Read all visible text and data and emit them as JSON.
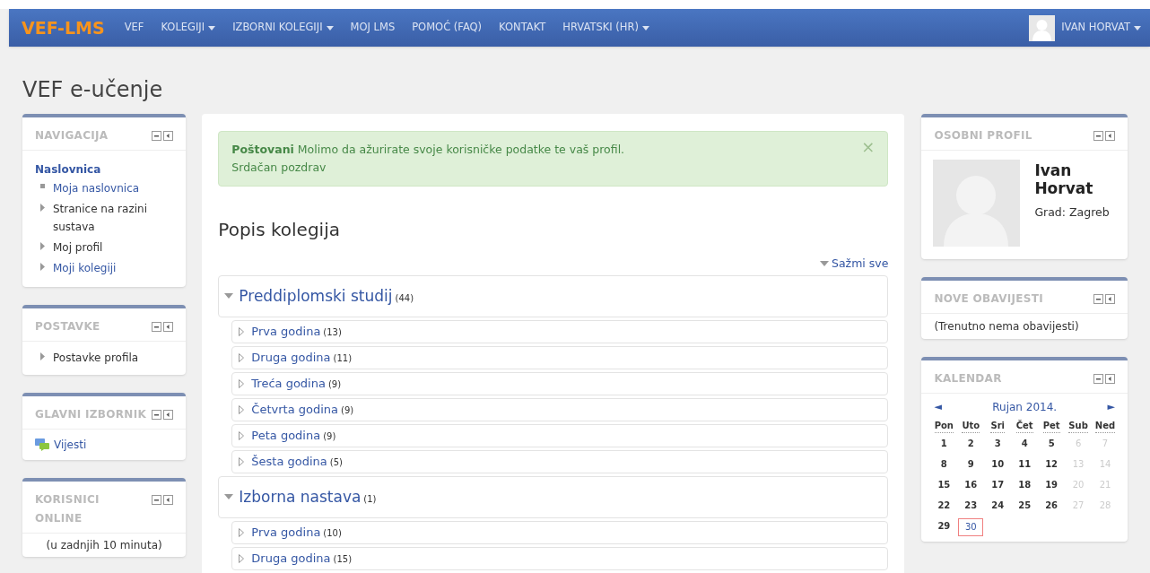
{
  "navbar": {
    "brand": "VEF-LMS",
    "items": [
      {
        "label": "VEF",
        "dropdown": false
      },
      {
        "label": "KOLEGIJI",
        "dropdown": true
      },
      {
        "label": "IZBORNI KOLEGIJI",
        "dropdown": true
      },
      {
        "label": "MOJ LMS",
        "dropdown": false
      },
      {
        "label": "POMOĆ (FAQ)",
        "dropdown": false
      },
      {
        "label": "KONTAKT",
        "dropdown": false
      },
      {
        "label": "HRVATSKI (HR)",
        "dropdown": true
      }
    ],
    "user": "IVAN HORVAT"
  },
  "page_title": "VEF e-učenje",
  "left_blocks": [
    {
      "kind": "tree",
      "title": "NAVIGACIJA",
      "root": "Naslovnica",
      "items": [
        {
          "label": "Moja naslovnica",
          "kind": "leaf",
          "link": true
        },
        {
          "label": "Stranice na razini sustava",
          "kind": "branch",
          "link": false
        },
        {
          "label": "Moj profil",
          "kind": "branch",
          "link": false
        },
        {
          "label": "Moji kolegiji",
          "kind": "branch",
          "link": true
        }
      ]
    },
    {
      "kind": "list",
      "title": "POSTAVKE",
      "items": [
        {
          "label": "Postavke profila",
          "kind": "branch",
          "link": false
        }
      ]
    },
    {
      "kind": "menu",
      "title": "GLAVNI IZBORNIK",
      "items": [
        {
          "label": "Vijesti"
        }
      ]
    },
    {
      "kind": "text",
      "title": "KORISNICI ONLINE",
      "text": "(u zadnjih 10 minuta)"
    }
  ],
  "alert": {
    "bold": "Poštovani",
    "message": "Molimo da ažurirate svoje korisničke podatke te vaš profil.",
    "line2": "Srdačan pozdrav",
    "close": "×"
  },
  "course_list": {
    "title": "Popis kolegija",
    "collapse_all": "Sažmi sve",
    "categories": [
      {
        "name": "Preddiplomski studij",
        "count": "(44)",
        "expanded": true,
        "children": [
          {
            "name": "Prva godina",
            "count": "(13)",
            "expanded": false
          },
          {
            "name": "Druga godina",
            "count": "(11)",
            "expanded": false
          },
          {
            "name": "Treća godina",
            "count": "(9)",
            "expanded": false
          },
          {
            "name": "Četvrta godina",
            "count": "(9)",
            "expanded": false
          },
          {
            "name": "Peta godina",
            "count": "(9)",
            "expanded": false
          },
          {
            "name": "Šesta godina",
            "count": "(5)",
            "expanded": false
          }
        ]
      },
      {
        "name": "Izborna nastava",
        "count": "(1)",
        "expanded": true,
        "children": [
          {
            "name": "Prva godina",
            "count": "(10)",
            "expanded": false
          },
          {
            "name": "Druga godina",
            "count": "(15)",
            "expanded": false
          }
        ]
      }
    ]
  },
  "right_blocks": [
    {
      "kind": "profile",
      "title": "OSOBNI PROFIL",
      "first_name": "Ivan",
      "last_name": "Horvat",
      "city": "Grad: Zagreb"
    },
    {
      "kind": "text",
      "title": "NOVE OBAVIJESTI",
      "text": "(Trenutno nema obavijesti)"
    },
    {
      "kind": "calendar",
      "title": "KALENDAR",
      "month": "Rujan 2014.",
      "prev": "◄",
      "next": "►",
      "weekdays": [
        "Pon",
        "Uto",
        "Sri",
        "Čet",
        "Pet",
        "Sub",
        "Ned"
      ],
      "weeks": [
        [
          {
            "day": "1",
            "weekend": false,
            "today": false
          },
          {
            "day": "2",
            "weekend": false,
            "today": false
          },
          {
            "day": "3",
            "weekend": false,
            "today": false
          },
          {
            "day": "4",
            "weekend": false,
            "today": false
          },
          {
            "day": "5",
            "weekend": false,
            "today": false
          },
          {
            "day": "6",
            "weekend": true,
            "today": false
          },
          {
            "day": "7",
            "weekend": true,
            "today": false
          }
        ],
        [
          {
            "day": "8",
            "weekend": false,
            "today": false
          },
          {
            "day": "9",
            "weekend": false,
            "today": false
          },
          {
            "day": "10",
            "weekend": false,
            "today": false
          },
          {
            "day": "11",
            "weekend": false,
            "today": false
          },
          {
            "day": "12",
            "weekend": false,
            "today": false
          },
          {
            "day": "13",
            "weekend": true,
            "today": false
          },
          {
            "day": "14",
            "weekend": true,
            "today": false
          }
        ],
        [
          {
            "day": "15",
            "weekend": false,
            "today": false
          },
          {
            "day": "16",
            "weekend": false,
            "today": false
          },
          {
            "day": "17",
            "weekend": false,
            "today": false
          },
          {
            "day": "18",
            "weekend": false,
            "today": false
          },
          {
            "day": "19",
            "weekend": false,
            "today": false
          },
          {
            "day": "20",
            "weekend": true,
            "today": false
          },
          {
            "day": "21",
            "weekend": true,
            "today": false
          }
        ],
        [
          {
            "day": "22",
            "weekend": false,
            "today": false
          },
          {
            "day": "23",
            "weekend": false,
            "today": false
          },
          {
            "day": "24",
            "weekend": false,
            "today": false
          },
          {
            "day": "25",
            "weekend": false,
            "today": false
          },
          {
            "day": "26",
            "weekend": false,
            "today": false
          },
          {
            "day": "27",
            "weekend": true,
            "today": false
          },
          {
            "day": "28",
            "weekend": true,
            "today": false
          }
        ],
        [
          {
            "day": "29",
            "weekend": false,
            "today": false
          },
          {
            "day": "30",
            "weekend": false,
            "today": true
          }
        ]
      ]
    }
  ]
}
